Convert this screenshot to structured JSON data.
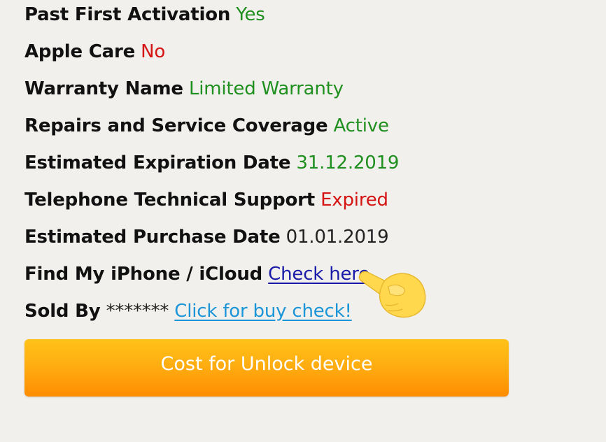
{
  "rows": [
    {
      "label": "Past First Activation",
      "value": "Yes",
      "value_color": "#1f8f1f"
    },
    {
      "label": "Apple Care",
      "value": "No",
      "value_color": "#d51414"
    },
    {
      "label": "Warranty Name",
      "value": "Limited Warranty",
      "value_color": "#1f8f1f"
    },
    {
      "label": "Repairs and Service Coverage",
      "value": "Active",
      "value_color": "#1f8f1f"
    },
    {
      "label": "Estimated Expiration Date",
      "value": "31.12.2019",
      "value_color": "#1f8f1f"
    },
    {
      "label": "Telephone Technical Support",
      "value": "Expired",
      "value_color": "#d51414"
    },
    {
      "label": "Estimated Purchase Date",
      "value": "01.01.2019",
      "value_color": "#222222"
    },
    {
      "label": "Find My iPhone / iCloud",
      "link": "Check here"
    },
    {
      "label": "Sold By",
      "value": "*******",
      "link": "Click for buy check!"
    }
  ],
  "cta": {
    "label": "Cost for Unlock device",
    "color_top": "#ffc21a",
    "color_bottom": "#ff8c00"
  },
  "icons": {
    "pointer": "pointing-hand-icon"
  }
}
